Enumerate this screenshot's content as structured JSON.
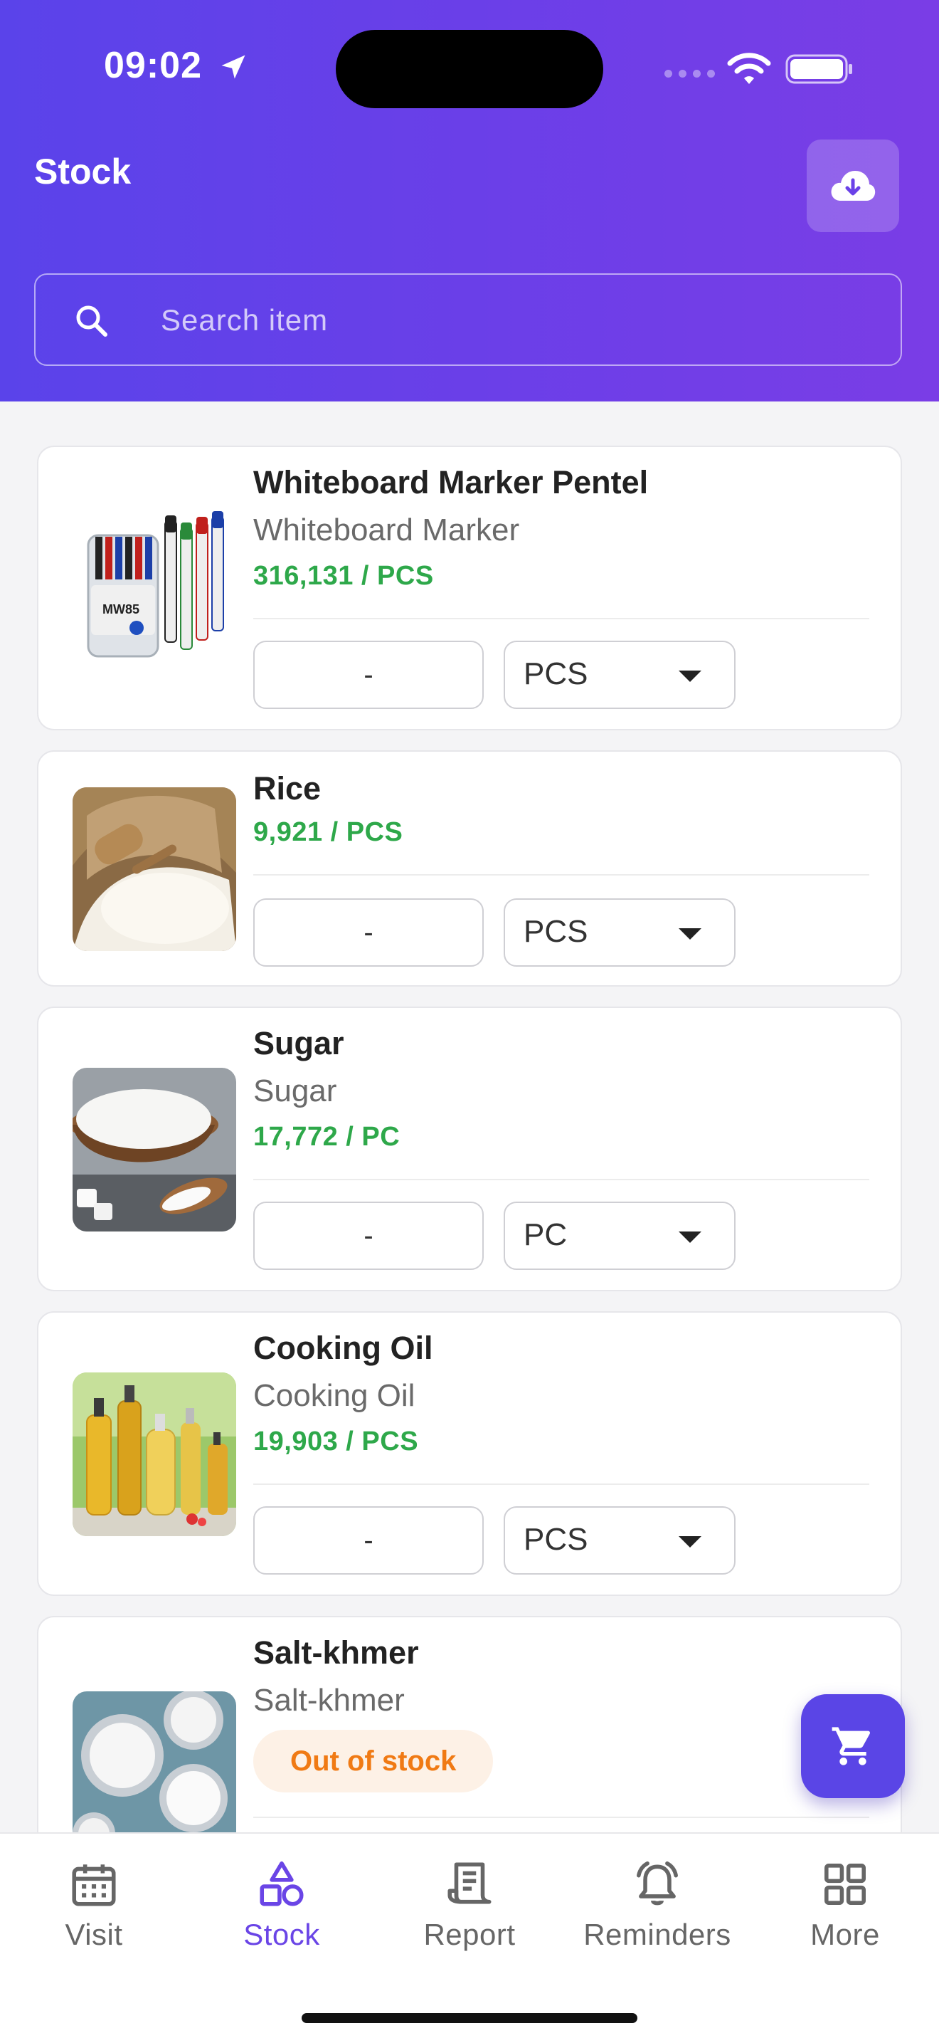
{
  "status_bar": {
    "time": "09:02"
  },
  "header": {
    "title": "Stock"
  },
  "search": {
    "placeholder": "Search item"
  },
  "colors": {
    "accent": "#5a45e6",
    "header_start": "#5a43ea",
    "header_end": "#7a3de6",
    "stock_qty": "#2ea84a",
    "out_of_stock": "#f07a14"
  },
  "items": [
    {
      "name": "Whiteboard Marker Pentel",
      "subtitle": "Whiteboard Marker",
      "stock": "316,131 / PCS",
      "qty": "-",
      "unit": "PCS",
      "image": "markers-image"
    },
    {
      "name": "Rice",
      "stock": "9,921 / PCS",
      "qty": "-",
      "unit": "PCS",
      "image": "rice-image"
    },
    {
      "name": "Sugar",
      "subtitle": "Sugar",
      "stock": "17,772 / PC",
      "qty": "-",
      "unit": "PC",
      "image": "sugar-image"
    },
    {
      "name": "Cooking Oil",
      "subtitle": "Cooking Oil",
      "stock": "19,903 / PCS",
      "qty": "-",
      "unit": "PCS",
      "image": "oil-image"
    },
    {
      "name": "Salt-khmer",
      "subtitle": "Salt-khmer",
      "status": "Out of stock",
      "image": "salt-image"
    }
  ],
  "fab": {
    "icon": "cart-icon"
  },
  "nav": {
    "active": "Stock",
    "items": [
      {
        "label": "Visit",
        "icon": "calendar-icon"
      },
      {
        "label": "Stock",
        "icon": "shapes-icon"
      },
      {
        "label": "Report",
        "icon": "receipt-icon"
      },
      {
        "label": "Reminders",
        "icon": "bell-icon"
      },
      {
        "label": "More",
        "icon": "grid-icon"
      }
    ]
  }
}
